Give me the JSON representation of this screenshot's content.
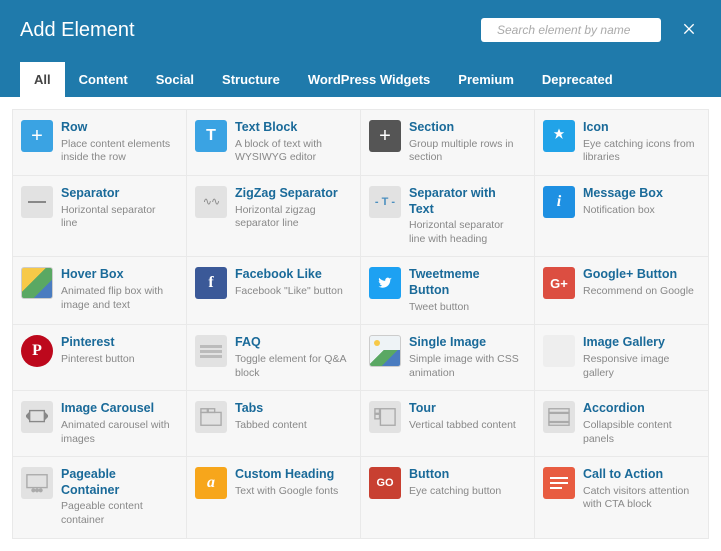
{
  "dialog": {
    "title": "Add Element"
  },
  "search": {
    "placeholder": "Search element by name"
  },
  "tabs": {
    "active": "All",
    "items": [
      "All",
      "Content",
      "Social",
      "Structure",
      "WordPress Widgets",
      "Premium",
      "Deprecated"
    ]
  },
  "elements": [
    {
      "title": "Row",
      "desc": "Place content elements inside the row",
      "icon": "row"
    },
    {
      "title": "Text Block",
      "desc": "A block of text with WYSIWYG editor",
      "icon": "text"
    },
    {
      "title": "Section",
      "desc": "Group multiple rows in section",
      "icon": "section"
    },
    {
      "title": "Icon",
      "desc": "Eye catching icons from libraries",
      "icon": "icon"
    },
    {
      "title": "Separator",
      "desc": "Horizontal separator line",
      "icon": "sep"
    },
    {
      "title": "ZigZag Separator",
      "desc": "Horizontal zigzag separator line",
      "icon": "zig"
    },
    {
      "title": "Separator with Text",
      "desc": "Horizontal separator line with heading",
      "icon": "sepT"
    },
    {
      "title": "Message Box",
      "desc": "Notification box",
      "icon": "msg"
    },
    {
      "title": "Hover Box",
      "desc": "Animated flip box with image and text",
      "icon": "hover"
    },
    {
      "title": "Facebook Like",
      "desc": "Facebook \"Like\" button",
      "icon": "fb"
    },
    {
      "title": "Tweetmeme Button",
      "desc": "Tweet button",
      "icon": "tw"
    },
    {
      "title": "Google+ Button",
      "desc": "Recommend on Google",
      "icon": "gp"
    },
    {
      "title": "Pinterest",
      "desc": "Pinterest button",
      "icon": "pin"
    },
    {
      "title": "FAQ",
      "desc": "Toggle element for Q&A block",
      "icon": "faq"
    },
    {
      "title": "Single Image",
      "desc": "Simple image with CSS animation",
      "icon": "img"
    },
    {
      "title": "Image Gallery",
      "desc": "Responsive image gallery",
      "icon": "gal"
    },
    {
      "title": "Image Carousel",
      "desc": "Animated carousel with images",
      "icon": "car"
    },
    {
      "title": "Tabs",
      "desc": "Tabbed content",
      "icon": "tabs"
    },
    {
      "title": "Tour",
      "desc": "Vertical tabbed content",
      "icon": "tour"
    },
    {
      "title": "Accordion",
      "desc": "Collapsible content panels",
      "icon": "acc"
    },
    {
      "title": "Pageable Container",
      "desc": "Pageable content container",
      "icon": "page"
    },
    {
      "title": "Custom Heading",
      "desc": "Text with Google fonts",
      "icon": "ch"
    },
    {
      "title": "Button",
      "desc": "Eye catching button",
      "icon": "btn"
    },
    {
      "title": "Call to Action",
      "desc": "Catch visitors attention with CTA block",
      "icon": "cta"
    }
  ]
}
